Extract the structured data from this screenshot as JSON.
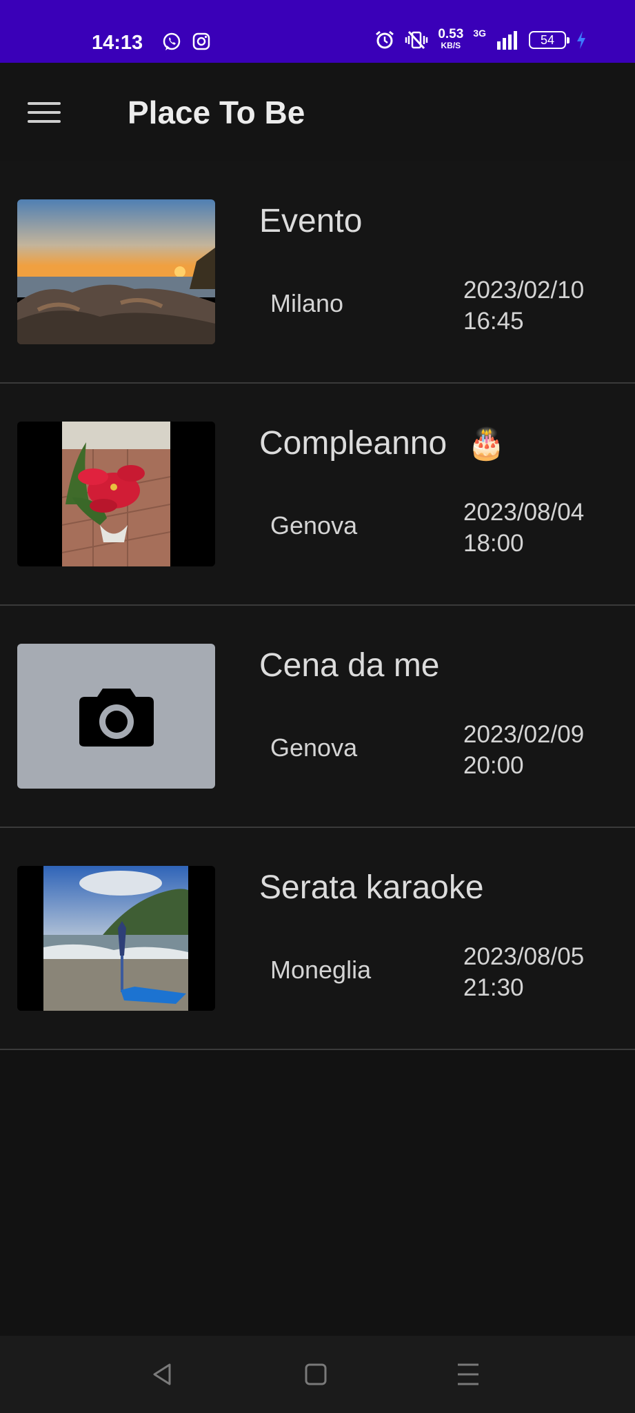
{
  "status_bar": {
    "time": "14:13",
    "left_icons": [
      "whatsapp-icon",
      "instagram-icon"
    ],
    "right_icons": [
      "alarm-icon",
      "vibrate-icon"
    ],
    "net_speed": "0.53",
    "net_speed_unit": "KB/S",
    "network_type": "3G",
    "battery_level": "54",
    "background_color": "#3a00b8"
  },
  "app_bar": {
    "menu_icon": "menu-icon",
    "title": "Place To Be"
  },
  "events": [
    {
      "title": "Evento",
      "emoji": "",
      "city": "Milano",
      "date": "2023/02/10",
      "time": "16:45",
      "image": "sunset-rocks-photo"
    },
    {
      "title": "Compleanno",
      "emoji": "🎂",
      "city": "Genova",
      "date": "2023/08/04",
      "time": "18:00",
      "image": "poinsettia-photo"
    },
    {
      "title": "Cena da me",
      "emoji": "",
      "city": "Genova",
      "date": "2023/02/09",
      "time": "20:00",
      "image": "camera-icon"
    },
    {
      "title": "Serata karaoke",
      "emoji": "",
      "city": "Moneglia",
      "date": "2023/08/05",
      "time": "21:30",
      "image": "beach-photo"
    }
  ],
  "nav_bar": {
    "icons": [
      "back-icon",
      "home-icon",
      "recents-icon"
    ]
  }
}
